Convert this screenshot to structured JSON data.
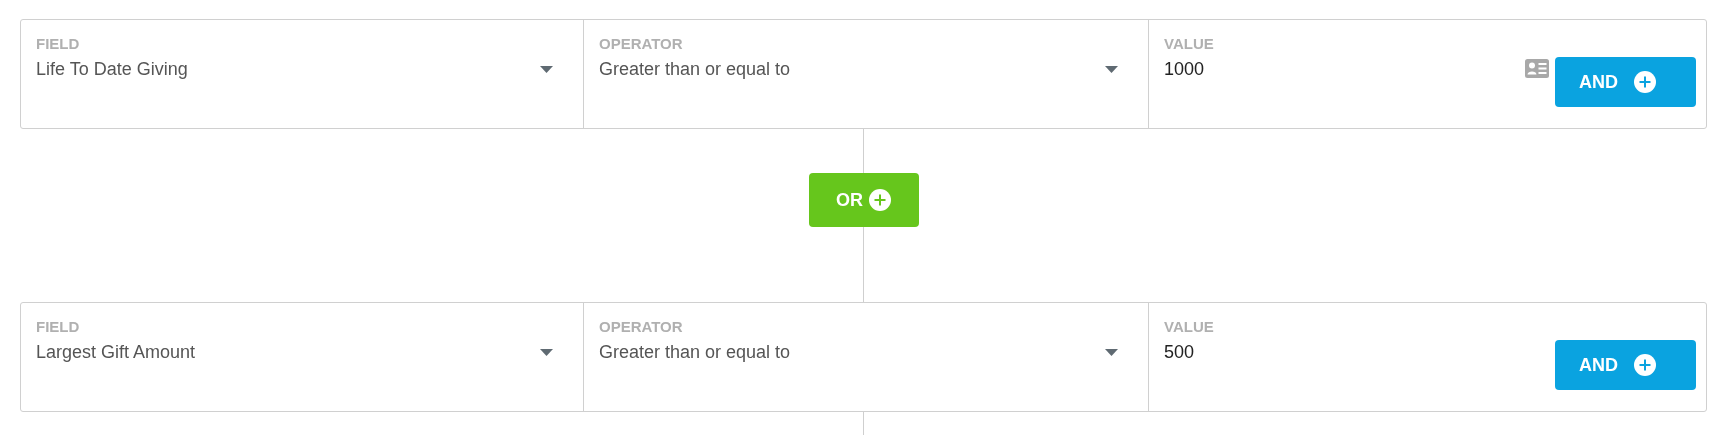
{
  "rules": [
    {
      "field_label": "FIELD",
      "field": "Life To Date Giving",
      "operator_label": "OPERATOR",
      "operator": "Greater than or equal to",
      "value_label": "VALUE",
      "value": "1000",
      "contact_icon": true,
      "and_button": "AND"
    },
    {
      "field_label": "FIELD",
      "field": "Largest Gift Amount",
      "operator_label": "OPERATOR",
      "operator": "Greater than or equal to",
      "value_label": "VALUE",
      "value": "500",
      "contact_icon": false,
      "and_button": "AND"
    }
  ],
  "or_button": "OR"
}
